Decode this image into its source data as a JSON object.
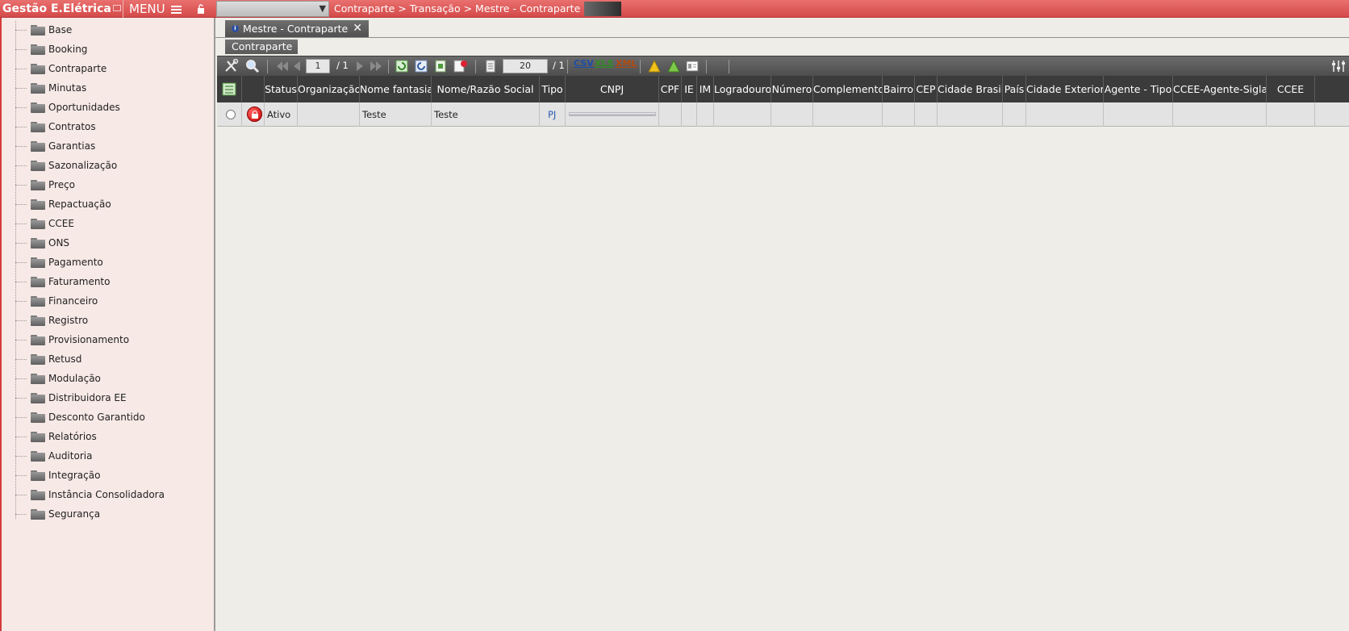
{
  "app": {
    "title": "Gestão E.Elétrica",
    "menu_label": "MENU"
  },
  "breadcrumb": "Contraparte > Transação > Mestre - Contraparte >",
  "sidebar": {
    "items": [
      {
        "label": "Base"
      },
      {
        "label": "Booking"
      },
      {
        "label": "Contraparte"
      },
      {
        "label": "Minutas"
      },
      {
        "label": "Oportunidades"
      },
      {
        "label": "Contratos"
      },
      {
        "label": "Garantias"
      },
      {
        "label": "Sazonalização"
      },
      {
        "label": "Preço"
      },
      {
        "label": "Repactuação"
      },
      {
        "label": "CCEE"
      },
      {
        "label": "ONS"
      },
      {
        "label": "Pagamento"
      },
      {
        "label": "Faturamento"
      },
      {
        "label": "Financeiro"
      },
      {
        "label": "Registro"
      },
      {
        "label": "Provisionamento"
      },
      {
        "label": "Retusd"
      },
      {
        "label": "Modulação"
      },
      {
        "label": "Distribuidora EE"
      },
      {
        "label": "Desconto Garantido"
      },
      {
        "label": "Relatórios"
      },
      {
        "label": "Auditoria"
      },
      {
        "label": "Integração"
      },
      {
        "label": "Instância Consolidadora"
      },
      {
        "label": "Segurança"
      }
    ]
  },
  "tabs": {
    "main_tab": "Mestre - Contraparte",
    "close_glyph": "✕",
    "sub_tab": "Contraparte"
  },
  "toolbar": {
    "page_current": "1",
    "page_total": "/ 1",
    "page_size": "20",
    "page_size_total": "/ 1",
    "csv_label": "CSV",
    "xls_label": "XLS",
    "xml_label": "XML"
  },
  "grid": {
    "headers": [
      "Status",
      "Organização",
      "Nome fantasia",
      "Nome/Razão Social",
      "Tipo",
      "CNPJ",
      "CPF",
      "IE",
      "IM",
      "Logradouro",
      "Número",
      "Complemento",
      "Bairro",
      "CEP",
      "Cidade Brasil",
      "País",
      "Cidade Exterior",
      "Agente - Tipo",
      "CCEE-Agente-Sigla",
      "CCEE"
    ],
    "rows": [
      {
        "status": "Ativo",
        "organizacao": "",
        "nome_fantasia": "Teste",
        "razao_social": "Teste",
        "tipo": "PJ"
      }
    ]
  },
  "colors": {
    "accent": "#d54a4a",
    "sidebar_bg": "#f7e9e6",
    "header_bg": "#3b3b3b",
    "link": "#2b5bb5"
  }
}
